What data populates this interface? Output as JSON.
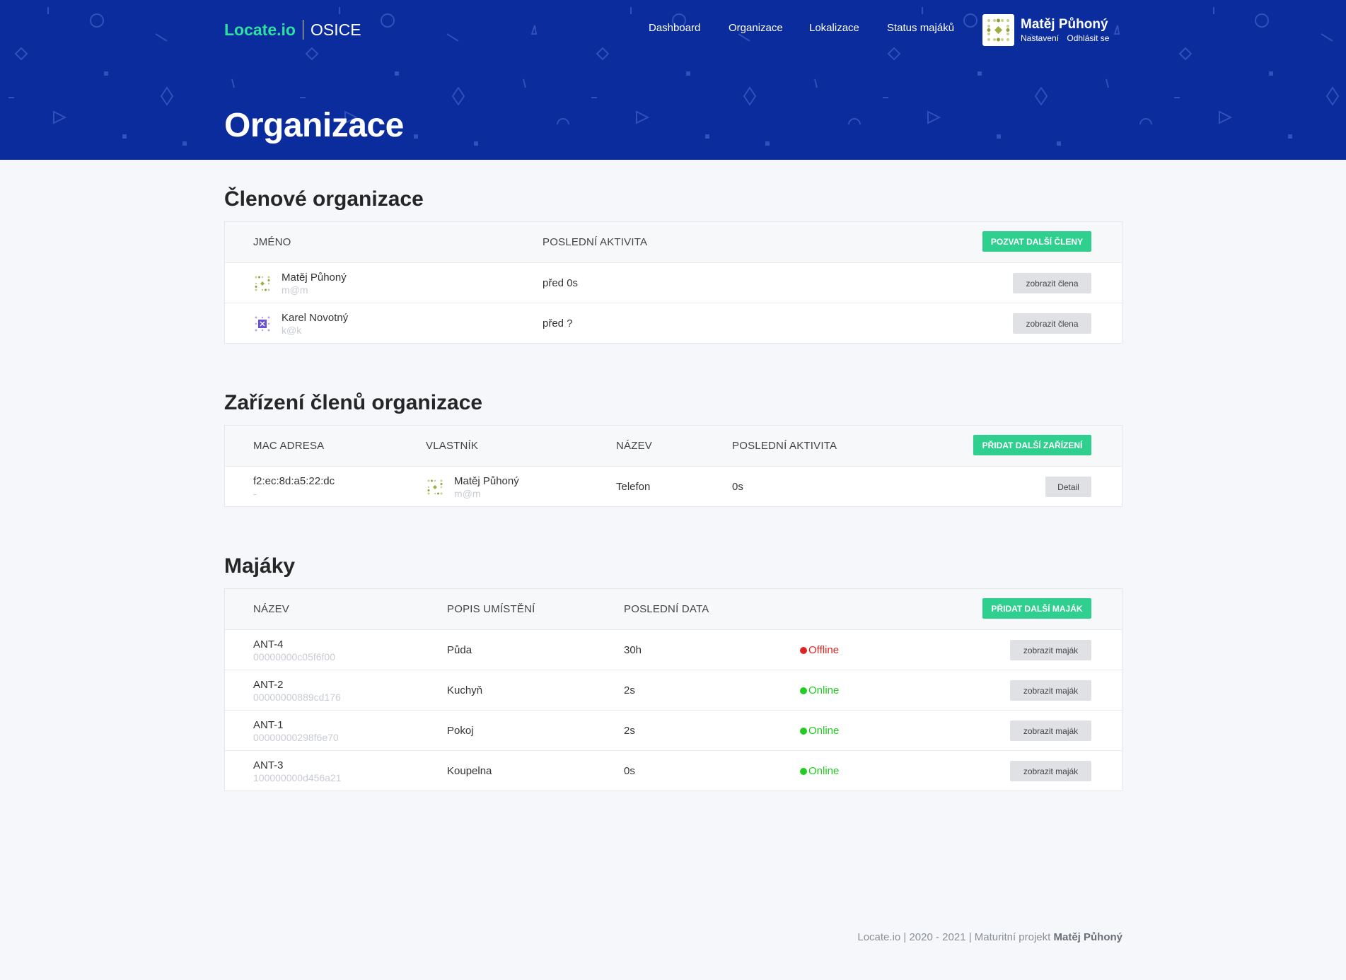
{
  "header": {
    "logo": "Locate.io",
    "org_name": "OSICE",
    "nav": [
      "Dashboard",
      "Organizace",
      "Lokalizace",
      "Status majáků"
    ],
    "user_name": "Matěj Půhoný",
    "user_links": [
      "Nastavení",
      "Odhlásit se"
    ],
    "page_title": "Organizace"
  },
  "members": {
    "title": "Členové organizace",
    "columns": [
      "JMÉNO",
      "POSLEDNÍ AKTIVITA"
    ],
    "invite_label": "POZVAT DALŠÍ ČLENY",
    "rows": [
      {
        "name": "Matěj Půhoný",
        "email": "m@m",
        "activity": "před 0s",
        "action": "zobrazit člena"
      },
      {
        "name": "Karel Novotný",
        "email": "k@k",
        "activity": "před ?",
        "action": "zobrazit člena"
      }
    ]
  },
  "devices": {
    "title": "Zařízení členů organizace",
    "columns": [
      "MAC ADRESA",
      "VLASTNÍK",
      "NÁZEV",
      "POSLEDNÍ AKTIVITA"
    ],
    "add_label": "PŘIDAT DALŠÍ ZAŘÍZENÍ",
    "rows": [
      {
        "mac": "f2:ec:8d:a5:22:dc",
        "mac_sub": "-",
        "owner": "Matěj Půhoný",
        "owner_email": "m@m",
        "name": "Telefon",
        "activity": "0s",
        "action": "Detail"
      }
    ]
  },
  "beacons": {
    "title": "Majáky",
    "columns": [
      "NÁZEV",
      "POPIS UMÍSTĚNÍ",
      "POSLEDNÍ DATA"
    ],
    "add_label": "PŘIDAT DALŠÍ MAJÁK",
    "rows": [
      {
        "name": "ANT-4",
        "id": "00000000c05f6f00",
        "location": "Půda",
        "last": "30h",
        "status": "Offline",
        "action": "zobrazit maják"
      },
      {
        "name": "ANT-2",
        "id": "00000000889cd176",
        "location": "Kuchyň",
        "last": "2s",
        "status": "Online",
        "action": "zobrazit maják"
      },
      {
        "name": "ANT-1",
        "id": "00000000298f6e70",
        "location": "Pokoj",
        "last": "2s",
        "status": "Online",
        "action": "zobrazit maják"
      },
      {
        "name": "ANT-3",
        "id": "100000000d456a21",
        "location": "Koupelna",
        "last": "0s",
        "status": "Online",
        "action": "zobrazit maják"
      }
    ]
  },
  "colors": {
    "header_bg": "#0a2c9c",
    "brand_green": "#2ee0a0",
    "button_green": "#2ecf8f",
    "online": "#22cc22",
    "offline": "#e02424"
  },
  "footer": {
    "text": "Locate.io | 2020 - 2021 | Maturitní projekt",
    "author": "Matěj Půhoný"
  }
}
